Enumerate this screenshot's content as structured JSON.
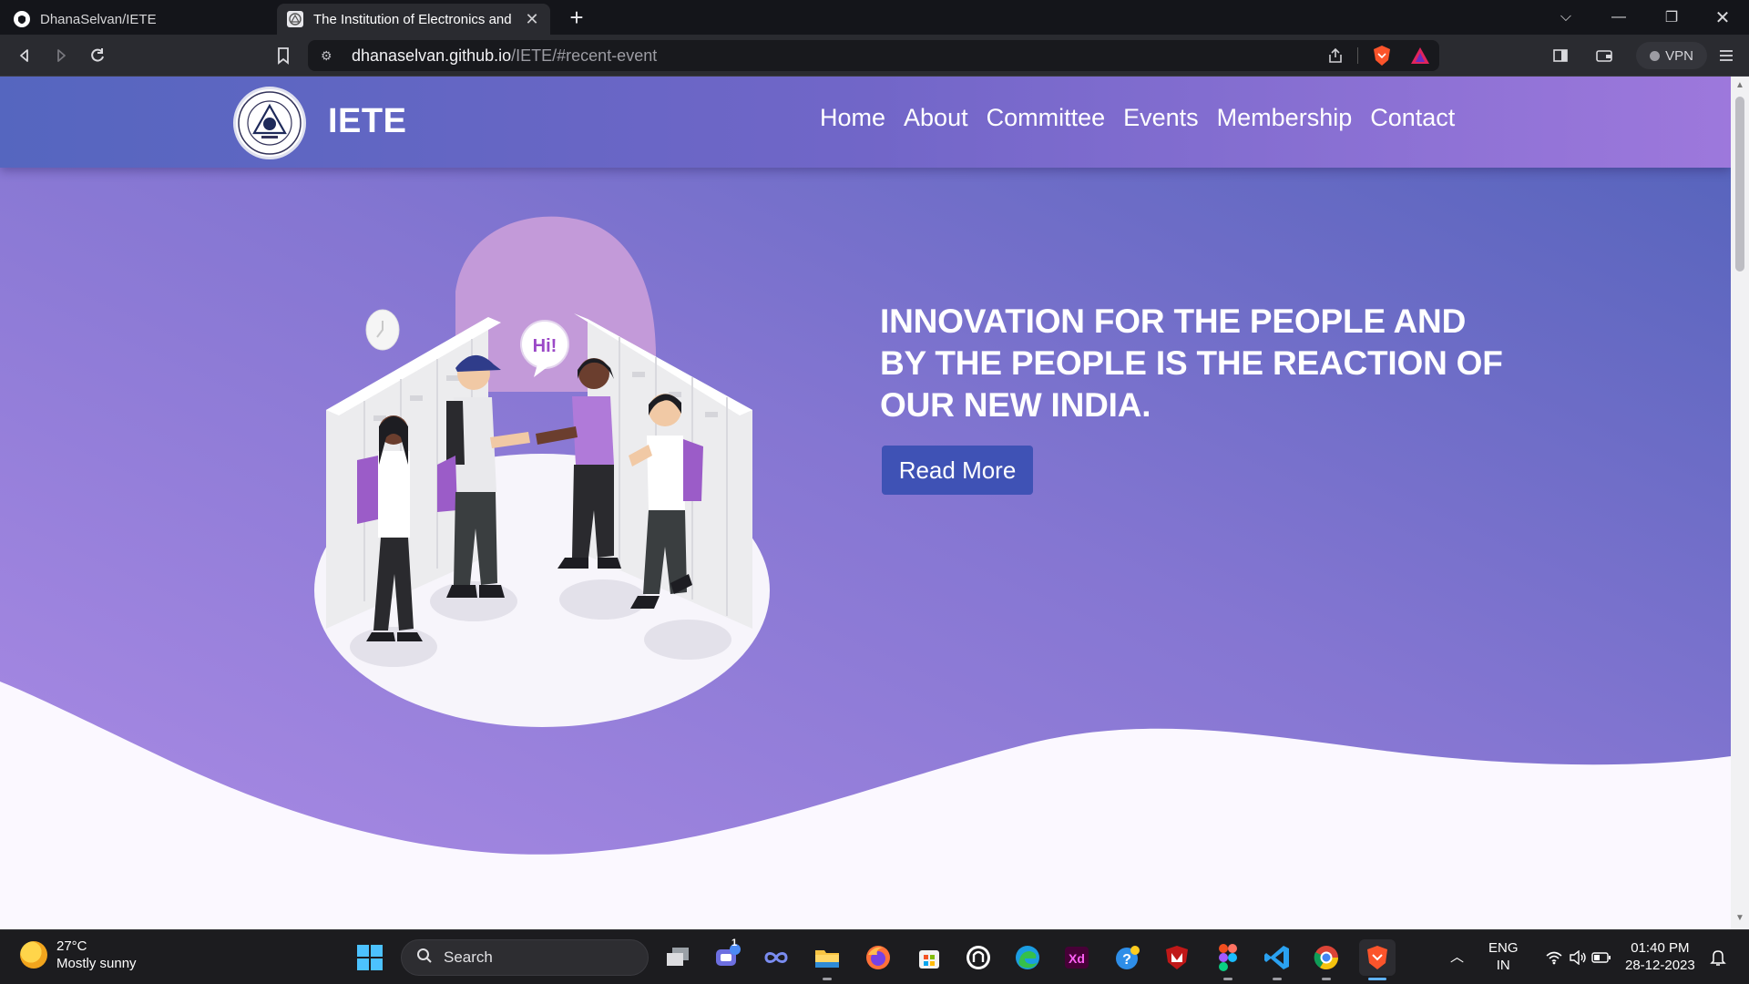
{
  "browser": {
    "tabs": [
      {
        "title": "DhanaSelvan/IETE",
        "active": false,
        "icon": "github-icon"
      },
      {
        "title": "The Institution of Electronics and",
        "active": true,
        "icon": "iete-favicon-icon"
      }
    ],
    "url_host": "dhanaselvan.github.io",
    "url_path": "/IETE/#recent-event",
    "vpn_label": "VPN"
  },
  "site": {
    "brand": "IETE",
    "nav": [
      "Home",
      "About",
      "Committee",
      "Events",
      "Membership",
      "Contact"
    ],
    "hero": {
      "headline": "INNOVATION FOR THE PEOPLE AND BY THE PEOPLE IS THE REACTION OF OUR NEW INDIA.",
      "button": "Read More",
      "speech_bubble": "Hi!"
    },
    "colors": {
      "nav_start": "#5566bf",
      "nav_end": "#9d78dc",
      "button": "#3f52b5",
      "hero_text": "#ffffff"
    }
  },
  "taskbar": {
    "weather_temp": "27°C",
    "weather_desc": "Mostly sunny",
    "search_label": "Search",
    "lang_top": "ENG",
    "lang_bottom": "IN",
    "time": "01:40 PM",
    "date": "28-12-2023",
    "teams_badge": "1"
  }
}
